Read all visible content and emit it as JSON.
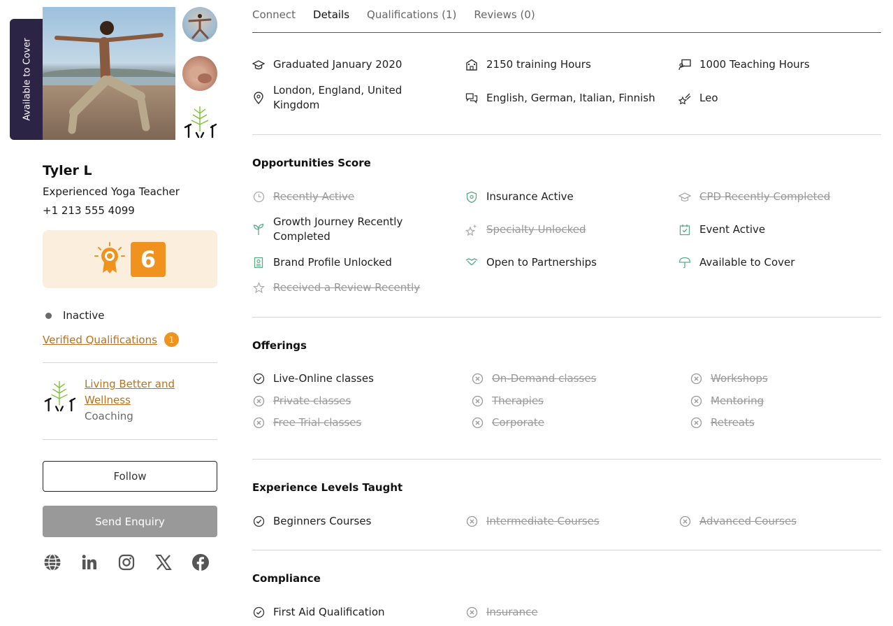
{
  "profile": {
    "cover_tab": "Available to Cover",
    "name": "Tyler L",
    "role": "Experienced Yoga Teacher",
    "phone": "+1 213 555 4099",
    "score": "6",
    "status": "Inactive",
    "verified_label": "Verified Qualifications",
    "verified_count": "1",
    "org_name": "Living Better and Wellness",
    "org_type": "Coaching",
    "follow_label": "Follow",
    "enquiry_label": "Send Enquiry",
    "accent": "#f0931e",
    "link_color": "#b7721f",
    "socials": [
      "globe-icon",
      "linkedin-icon",
      "instagram-icon",
      "x-icon",
      "facebook-icon"
    ]
  },
  "tabs": [
    "Connect",
    "Details",
    "Qualifications (1)",
    "Reviews (0)"
  ],
  "active_tab": "Details",
  "details": {
    "graduated": "Graduated January 2020",
    "training_hours": "2150 training Hours",
    "teaching_hours": "1000 Teaching Hours",
    "location": "London, England, United Kingdom",
    "languages": "English, German, Italian, Finnish",
    "star_sign": "Leo"
  },
  "opportunities": {
    "title": "Opportunities Score",
    "items": [
      {
        "label": "Recently Active",
        "active": false
      },
      {
        "label": "Insurance Active",
        "active": true
      },
      {
        "label": "CPD Recently Completed",
        "active": false
      },
      {
        "label": "Growth Journey Recently Completed",
        "active": true
      },
      {
        "label": "Specialty Unlocked",
        "active": false
      },
      {
        "label": "Event Active",
        "active": true
      },
      {
        "label": "Brand Profile Unlocked",
        "active": true
      },
      {
        "label": "Open to Partnerships",
        "active": true
      },
      {
        "label": "Available to Cover",
        "active": true
      },
      {
        "label": "Received a Review Recently",
        "active": false
      }
    ]
  },
  "offerings": {
    "title": "Offerings",
    "items": [
      {
        "label": "Live-Online classes",
        "active": true
      },
      {
        "label": "On-Demand classes",
        "active": false
      },
      {
        "label": "Workshops",
        "active": false
      },
      {
        "label": "Private classes",
        "active": false
      },
      {
        "label": "Therapies",
        "active": false
      },
      {
        "label": "Mentoring",
        "active": false
      },
      {
        "label": "Free Trial classes",
        "active": false
      },
      {
        "label": "Corporate",
        "active": false
      },
      {
        "label": "Retreats",
        "active": false
      }
    ]
  },
  "experience": {
    "title": "Experience Levels Taught",
    "items": [
      {
        "label": "Beginners Courses",
        "active": true
      },
      {
        "label": "Intermediate Courses",
        "active": false
      },
      {
        "label": "Advanced Courses",
        "active": false
      }
    ]
  },
  "compliance": {
    "title": "Compliance",
    "items": [
      {
        "label": "First Aid Qualification",
        "active": true
      },
      {
        "label": "Insurance",
        "active": false
      }
    ]
  }
}
